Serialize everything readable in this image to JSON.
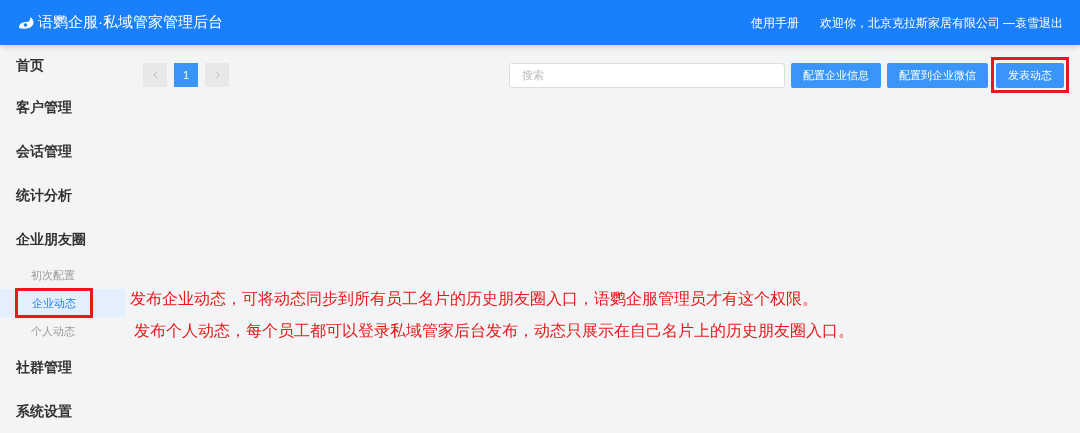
{
  "header": {
    "title": "语鹦企服·私域管家管理后台",
    "manual_link": "使用手册",
    "welcome": "欢迎你，北京克拉斯家居有限公司 —袁雪",
    "logout": "退出"
  },
  "sidebar": {
    "items": [
      {
        "label": "首页"
      },
      {
        "label": "客户管理"
      },
      {
        "label": "会话管理"
      },
      {
        "label": "统计分析"
      },
      {
        "label": "企业朋友圈",
        "children": [
          {
            "label": "初次配置",
            "selected": false,
            "annotated": false
          },
          {
            "label": "企业动态",
            "selected": true,
            "annotated": true
          },
          {
            "label": "个人动态",
            "selected": false,
            "annotated": false
          }
        ]
      },
      {
        "label": "社群管理"
      },
      {
        "label": "系统设置"
      }
    ]
  },
  "pagination": {
    "pages": [
      {
        "label": "1",
        "selected": true
      }
    ]
  },
  "search": {
    "placeholder": "搜索"
  },
  "buttons": [
    {
      "label": "配置企业信息",
      "annotated": false
    },
    {
      "label": "配置到企业微信",
      "annotated": false
    },
    {
      "label": "发表动态",
      "annotated": true
    }
  ],
  "annotations": [
    "发布企业动态，可将动态同步到所有员工名片的历史朋友圈入口，语鹦企服管理员才有这个权限。",
    "发布个人动态，每个员工都可以登录私域管家后台发布，动态只展示在自己名片上的历史朋友圈入口。"
  ]
}
